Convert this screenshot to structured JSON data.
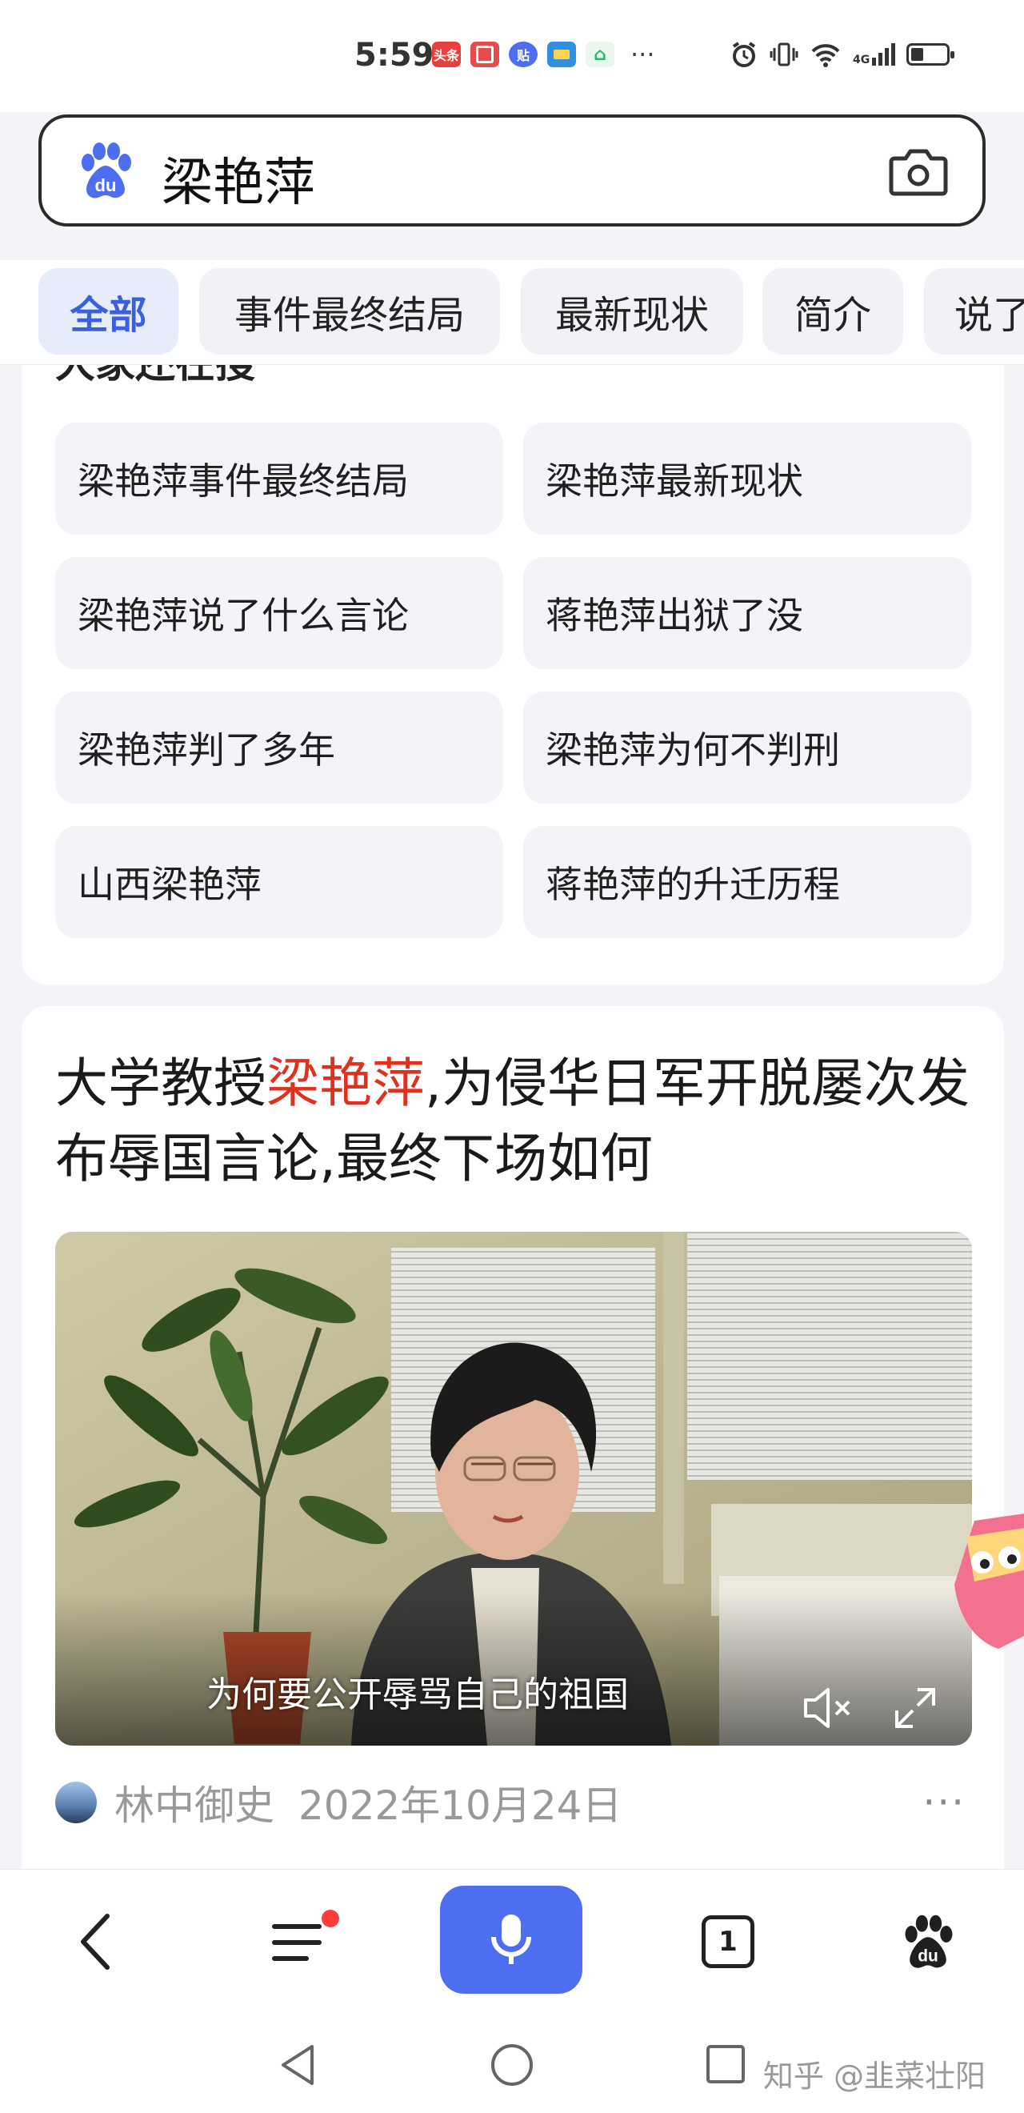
{
  "status_bar": {
    "time": "5:59",
    "app_icons": [
      {
        "name": "toutiao-icon",
        "label": "头条",
        "color": "#e8413c"
      },
      {
        "name": "red-book-icon",
        "label": "",
        "color": "#e94a4a"
      },
      {
        "name": "tieba-icon",
        "label": "贴",
        "color": "#4e6ef2"
      },
      {
        "name": "map-icon",
        "label": "",
        "color": "#2f8fe0"
      },
      {
        "name": "home-app-icon",
        "label": "",
        "color": "#2bb673"
      }
    ],
    "more": "···",
    "network": "4G"
  },
  "search": {
    "query": "梁艳萍",
    "logo_color": "#4e6ef2"
  },
  "tabs": [
    {
      "label": "全部",
      "active": true
    },
    {
      "label": "事件最终结局",
      "active": false
    },
    {
      "label": "最新现状",
      "active": false
    },
    {
      "label": "简介",
      "active": false
    },
    {
      "label": "说了",
      "active": false
    }
  ],
  "related": {
    "title_cut": "大家还在搜",
    "items": [
      "梁艳萍事件最终结局",
      "梁艳萍最新现状",
      "梁艳萍说了什么言论",
      "蒋艳萍出狱了没",
      "梁艳萍判了多年",
      "梁艳萍为何不判刑",
      "山西梁艳萍",
      "蒋艳萍的升迁历程"
    ]
  },
  "article": {
    "title_prefix": "大学教授",
    "title_highlight": "梁艳萍",
    "title_suffix": ",为侵华日军开脱屡次发布辱国言论,最终下场如何",
    "highlight_color": "#e0301e",
    "video_subtitle": "为何要公开辱骂自己的祖国",
    "author": "林中御史",
    "date": "2022年10月24日",
    "more": "···"
  },
  "toolbar": {
    "tab_count": "1",
    "accent": "#4e6ef2"
  },
  "watermark": "知乎 @韭菜壮阳"
}
